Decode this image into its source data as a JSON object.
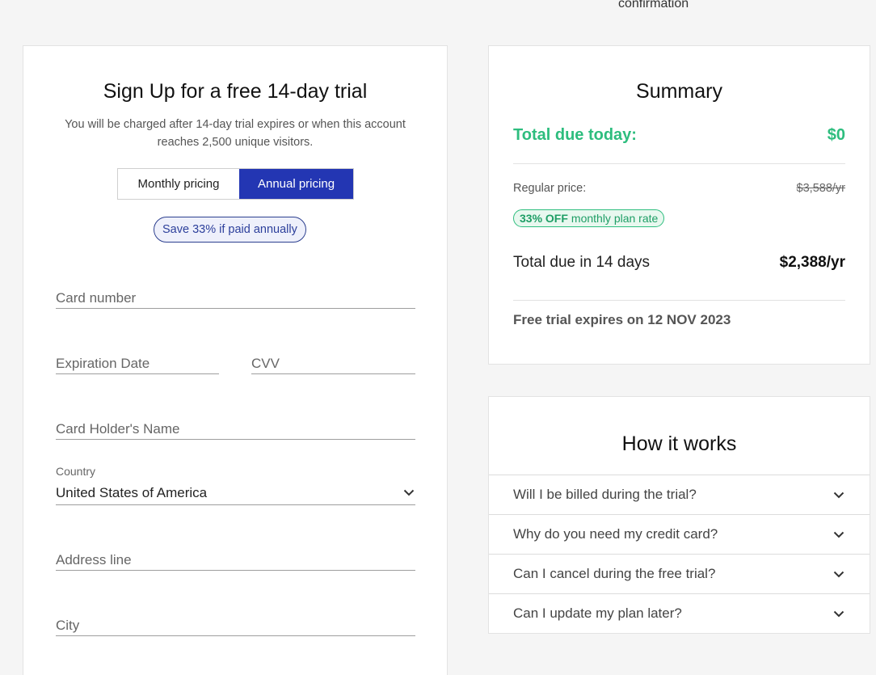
{
  "top_step": "confirmation",
  "signup": {
    "title": "Sign Up for a free 14-day trial",
    "subtitle": "You will be charged after 14-day trial expires or when this account reaches 2,500 unique visitors.",
    "pricing_toggle": {
      "monthly_label": "Monthly pricing",
      "annual_label": "Annual pricing",
      "selected": "annual"
    },
    "save_badge": "Save 33% if paid annually",
    "fields": {
      "card_number": {
        "placeholder": "Card number",
        "value": ""
      },
      "expiration": {
        "placeholder": "Expiration Date",
        "value": ""
      },
      "cvv": {
        "placeholder": "CVV",
        "value": ""
      },
      "holder": {
        "placeholder": "Card Holder's Name",
        "value": ""
      },
      "country": {
        "label": "Country",
        "value": "United States of America"
      },
      "address": {
        "placeholder": "Address line",
        "value": ""
      },
      "city": {
        "placeholder": "City",
        "value": ""
      }
    }
  },
  "summary": {
    "title": "Summary",
    "total_due_label": "Total due today:",
    "total_due_value": "$0",
    "regular_label": "Regular price:",
    "regular_value": "$3,588/yr",
    "off_bold": "33% OFF",
    "off_text": "monthly plan rate",
    "total14_label": "Total due in 14 days",
    "total14_value": "$2,388/yr",
    "expires": "Free trial expires on 12 NOV 2023"
  },
  "how": {
    "title": "How it works",
    "faqs": [
      "Will I be billed during the trial?",
      "Why do you need my credit card?",
      "Can I cancel during the free trial?",
      "Can I update my plan later?"
    ]
  },
  "colors": {
    "accent_blue": "#2336b3",
    "accent_green": "#2dbd7e"
  },
  "icons": {
    "dropdown": "chevron-down-icon"
  }
}
